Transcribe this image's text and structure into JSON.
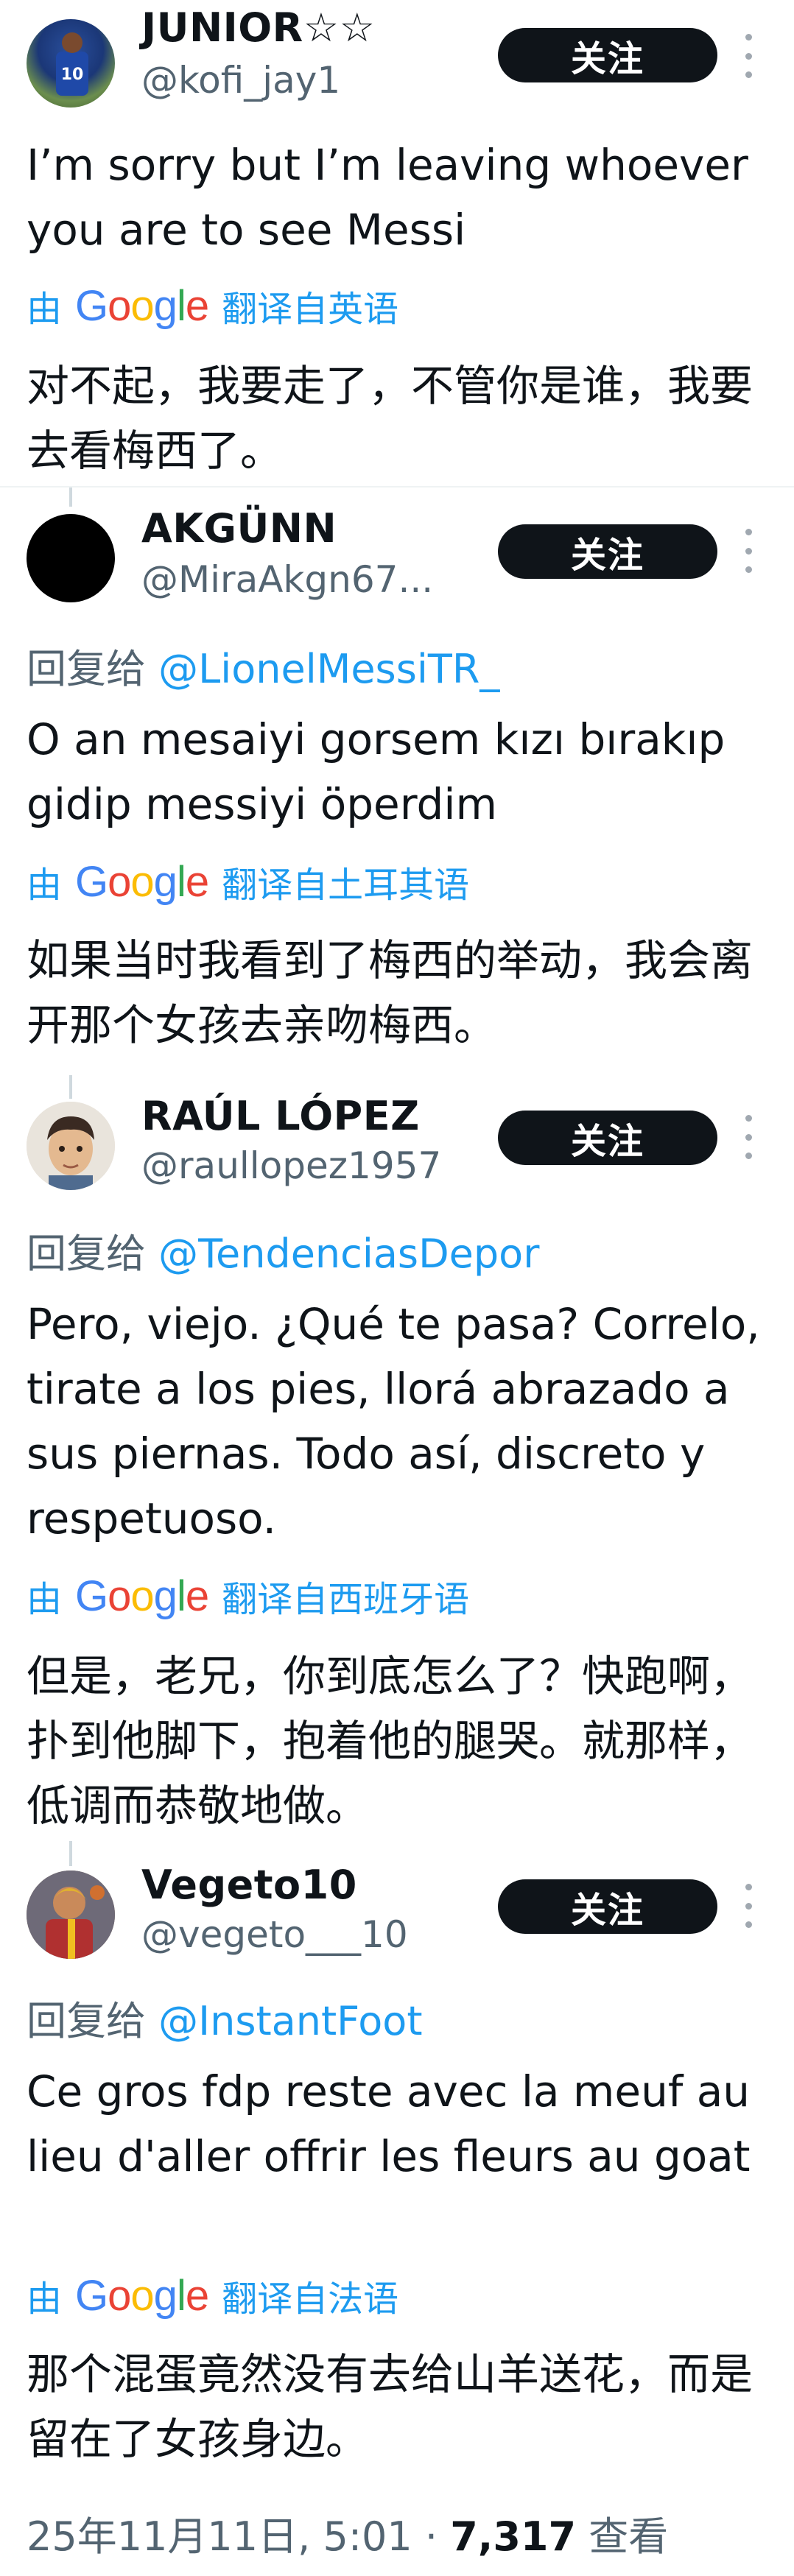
{
  "posts": [
    {
      "name": "JUNIOR☆☆",
      "handle": "@kofi_jay1",
      "follow_label": "关注",
      "body": "I’m sorry but I’m leaving whoever you are to see Messi",
      "translate_prefix": "由",
      "translate_brand": "Google",
      "translate_suffix": "翻译自英语",
      "translated": "对不起，我要走了，不管你是谁，我要去看梅西了。"
    },
    {
      "name": "AKGÜNN",
      "handle": "@MiraAkgn67...",
      "follow_label": "关注",
      "reply_prefix": "回复给",
      "reply_to": "@LionelMessiTR_",
      "body": "O an mesaiyi gorsem kızı bırakıp gidip messiyi öperdim",
      "translate_prefix": "由",
      "translate_brand": "Google",
      "translate_suffix": "翻译自土耳其语",
      "translated": "如果当时我看到了梅西的举动，我会离开那个女孩去亲吻梅西。"
    },
    {
      "name": "RAÚL LÓPEZ",
      "handle": "@raullopez1957",
      "follow_label": "关注",
      "reply_prefix": "回复给",
      "reply_to": "@TendenciasDepor",
      "body": "Pero, viejo. ¿Qué te pasa? Correlo, tirate a los pies, llorá abrazado a sus piernas. Todo así, discreto y respetuoso.",
      "translate_prefix": "由",
      "translate_brand": "Google",
      "translate_suffix": "翻译自西班牙语",
      "translated": "但是，老兄，你到底怎么了？快跑啊，扑到他脚下，抱着他的腿哭。就那样，低调而恭敬地做。"
    },
    {
      "name": "Vegeto10",
      "handle": "@vegeto___10",
      "follow_label": "关注",
      "reply_prefix": "回复给",
      "reply_to": "@InstantFoot",
      "body": "Ce gros fdp reste avec la meuf au lieu d'aller offrir les fleurs au goat",
      "translate_prefix": "由",
      "translate_brand": "Google",
      "translate_suffix": "翻译自法语",
      "translated": "那个混蛋竟然没有去给山羊送花，而是留在了女孩身边。"
    }
  ],
  "footer": {
    "timestamp": "25年11月11日, 5:01 · ",
    "views": "7,317",
    "views_label": " 查看"
  },
  "colors": {
    "link": "#1d9bf0",
    "secondary": "#536471",
    "follow_bg": "#0f1419"
  },
  "icons": [
    "more-options-icon",
    "google-logo"
  ]
}
